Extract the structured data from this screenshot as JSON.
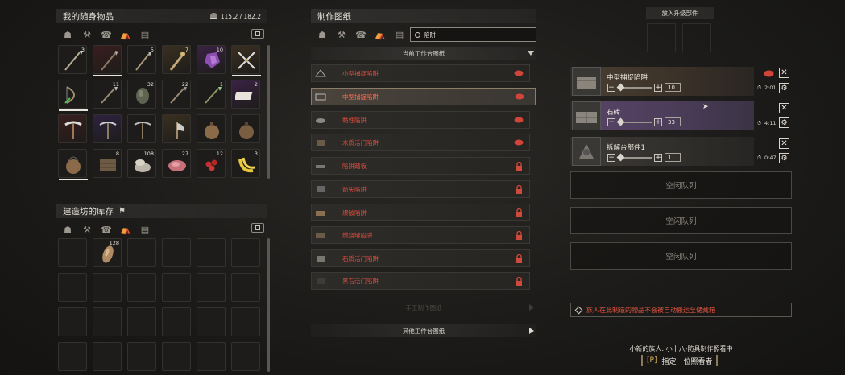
{
  "inventory": {
    "title": "我的随身物品",
    "weight": "115.2 / 182.2",
    "counts": [
      "3",
      "5",
      "7",
      "10",
      "11",
      "32",
      "22",
      "1",
      "2",
      "8",
      "108",
      "27",
      "12",
      "3"
    ]
  },
  "storage": {
    "title": "建造坊的库存",
    "counts": [
      "128"
    ]
  },
  "recipes": {
    "title": "制作图纸",
    "search_value": "陷阱",
    "station_header": "当前工作台图纸",
    "items": [
      "小型捕捉陷阱",
      "中型捕捉陷阱",
      "黏性陷阱",
      "木质活门陷阱",
      "陷阱踏板",
      "箭矢陷阱",
      "爆破陷阱",
      "燃烧罐陷阱",
      "石质活门陷阱",
      "黑石活门陷阱"
    ],
    "manual_header": "手工制作图纸",
    "other_header": "其他工作台图纸"
  },
  "upgrade": {
    "label": "放入升级部件"
  },
  "queue": {
    "items": [
      {
        "name": "中型捕捉陷阱",
        "qty": "10",
        "time": "2:01"
      },
      {
        "name": "石砖",
        "qty": "33",
        "time": "4:11"
      },
      {
        "name": "拆解台部件1",
        "qty": "1",
        "time": "0:47"
      }
    ],
    "idle_label": "空闲队列",
    "warning": "族人在此制造的物品不会被自动搬运至储藏箱"
  },
  "footer": {
    "thrall": "小新的族人: 小十八-防具制作照看中",
    "key": "[P]",
    "action": "指定一位照看者"
  }
}
